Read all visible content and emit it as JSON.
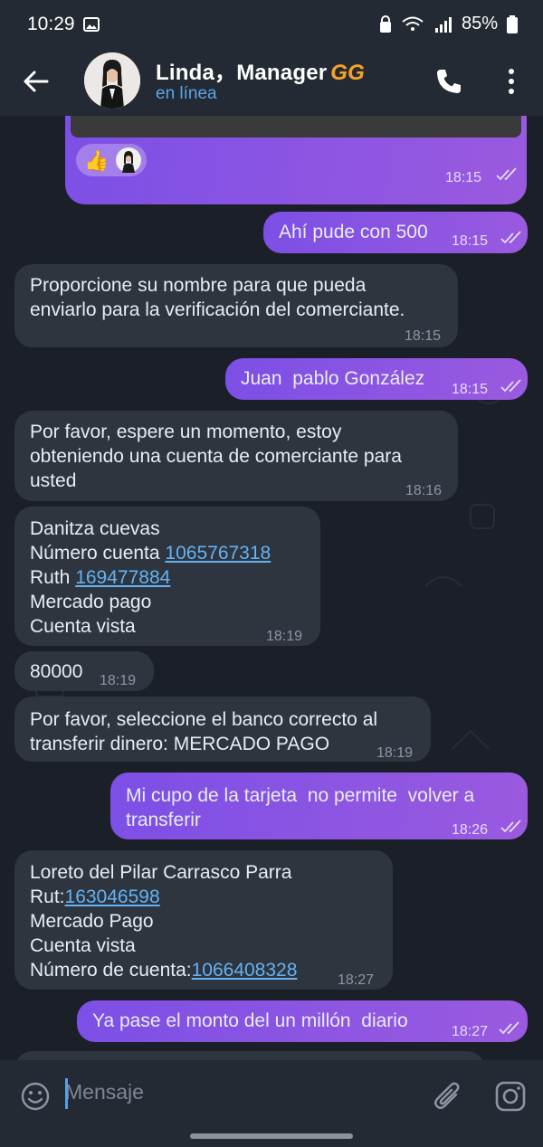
{
  "status": {
    "time": "10:29",
    "battery": "85%"
  },
  "header": {
    "name": "Linda，Manager",
    "badge": "GG",
    "status": "en línea"
  },
  "messages": [
    {
      "dir": "out",
      "reactions": [
        "👍"
      ],
      "time": "18:15"
    },
    {
      "dir": "out",
      "text": "Ahí pude con 500",
      "time": "18:15"
    },
    {
      "dir": "in",
      "line1": "Proporcione su nombre para que pueda",
      "line2": "enviarlo para la verificación del comerciante.",
      "time": "18:15"
    },
    {
      "dir": "out",
      "text": "Juan  pablo González",
      "time": "18:15"
    },
    {
      "dir": "in",
      "line1": "Por favor, espere un momento, estoy",
      "line2": "obteniendo una cuenta de comerciante para",
      "line3": "usted",
      "time": "18:16"
    },
    {
      "dir": "in",
      "line1": "Danitza cuevas",
      "line2_label": "Número cuenta ",
      "line2_link": "1065767318",
      "line3_label": "Ruth ",
      "line3_link": "169477884",
      "line4": "Mercado pago",
      "line5": "Cuenta vista",
      "time": "18:19"
    },
    {
      "dir": "in",
      "text": "80000",
      "time": "18:19"
    },
    {
      "dir": "in",
      "line1": "Por favor, seleccione el banco correcto al",
      "line2": "transferir dinero: MERCADO PAGO",
      "time": "18:19"
    },
    {
      "dir": "out",
      "line1": "Mi cupo de la tarjeta  no permite  volver a",
      "line2": "transferir",
      "time": "18:26"
    },
    {
      "dir": "in",
      "line1": "Loreto del Pilar Carrasco Parra",
      "line2_label": "Rut:",
      "line2_link": "163046598",
      "line3": "Mercado Pago",
      "line4": "Cuenta vista",
      "line5_label": "Número de cuenta:",
      "line5_link": "1066408328",
      "time": "18:27"
    },
    {
      "dir": "out",
      "text": "Ya pase el monto del un millón  diario",
      "time": "18:27"
    }
  ],
  "composer": {
    "placeholder": "Mensaje"
  }
}
